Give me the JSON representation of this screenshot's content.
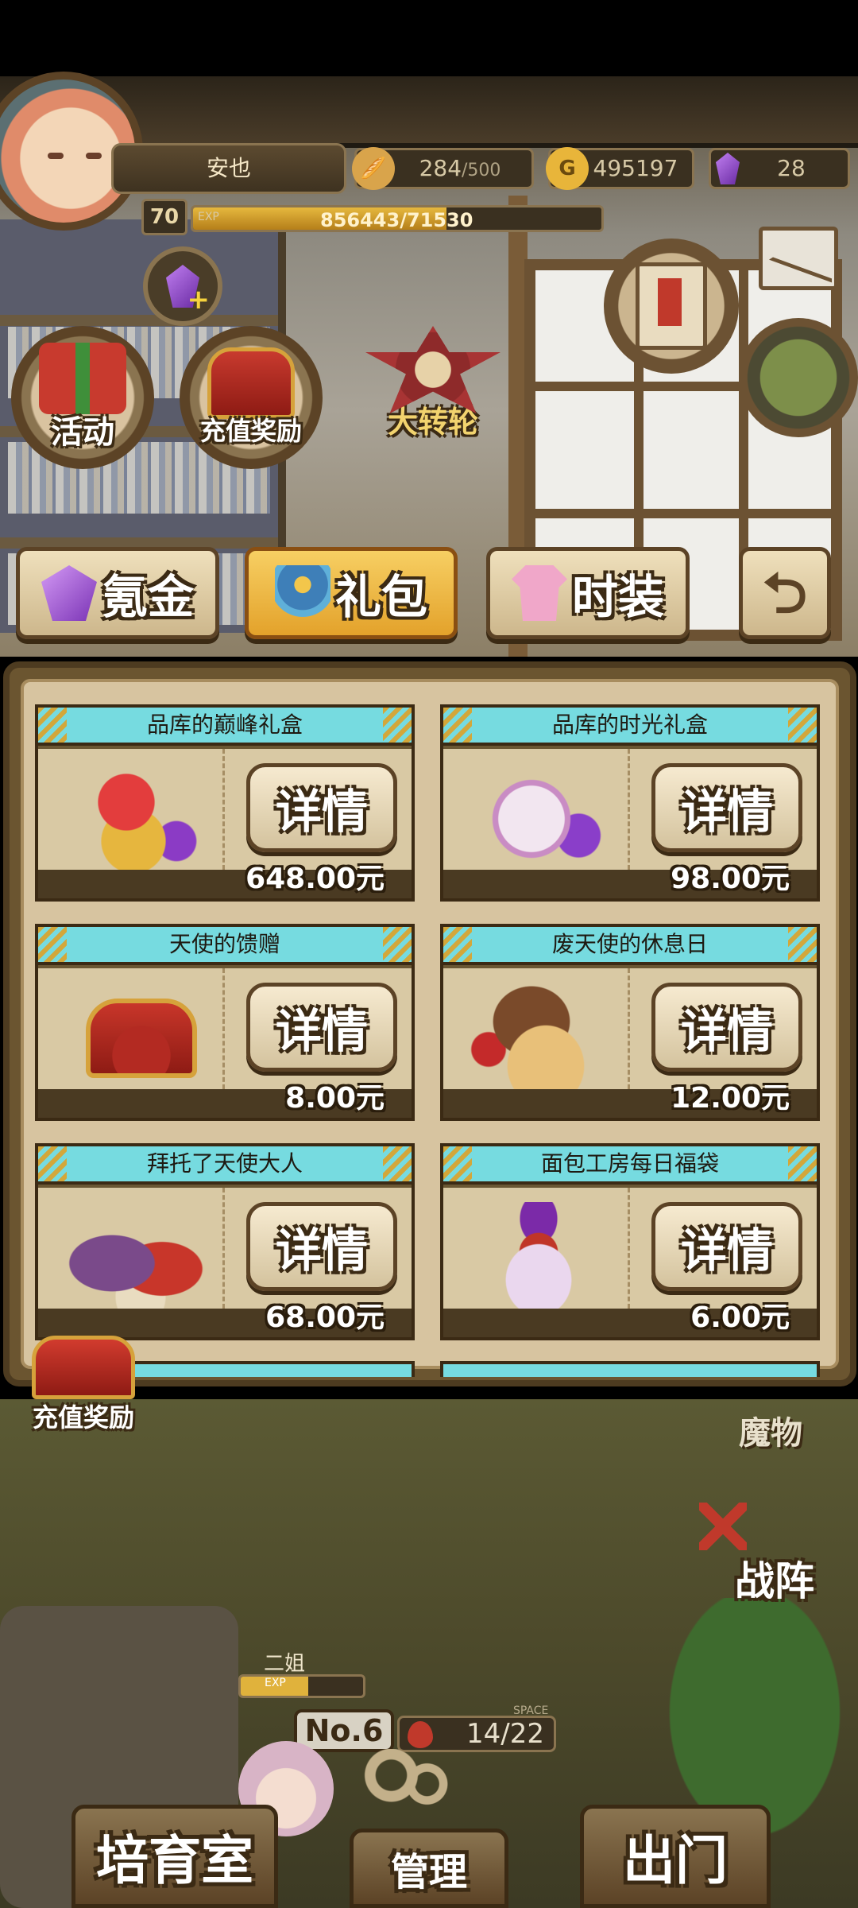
{
  "profile": {
    "name": "安也",
    "level": "70",
    "exp_label": "EXP",
    "exp_text": "856443/71530",
    "exp_fraction": 0.62
  },
  "resources": {
    "bread": "284",
    "bread_max": "/500",
    "gold": "495197",
    "gems": "28"
  },
  "shortcuts": {
    "activity": "活动",
    "recharge_reward": "充值奖励",
    "big_wheel": "大转轮"
  },
  "tabs": [
    {
      "label": "氪金"
    },
    {
      "label": "礼包"
    },
    {
      "label": "时装"
    }
  ],
  "shop": {
    "detail_label": "详情",
    "items": [
      {
        "title": "品库的巅峰礼盒",
        "price": "648.00元",
        "icon": "gift-pile-icon"
      },
      {
        "title": "品库的时光礼盒",
        "price": "98.00元",
        "icon": "hourglass-bottle-icon"
      },
      {
        "title": "天使的馈赠",
        "price": "8.00元",
        "icon": "red-chest-icon"
      },
      {
        "title": "废天使的休息日",
        "price": "12.00元",
        "icon": "picnic-basket-icon"
      },
      {
        "title": "拜托了天使大人",
        "price": "68.00元",
        "icon": "chest-bundle-icon"
      },
      {
        "title": "面包工房每日福袋",
        "price": "6.00元",
        "icon": "lucky-bag-icon"
      }
    ]
  },
  "floating": {
    "recharge_reward": "充值奖励"
  },
  "lower": {
    "monster_sign": "魔物",
    "battle": "战阵",
    "pet_name": "二姐",
    "pet_exp_label": "EXP",
    "pet_exp_fraction": 0.55,
    "room_no": "No.6",
    "capacity": "14/22",
    "space_label": "SPACE",
    "nav": [
      "培育室",
      "管理",
      "出门"
    ]
  },
  "colors": {
    "accent_gold": "#e3a22b",
    "card_header": "#76dbe0",
    "panel_brown": "#6b5530"
  }
}
